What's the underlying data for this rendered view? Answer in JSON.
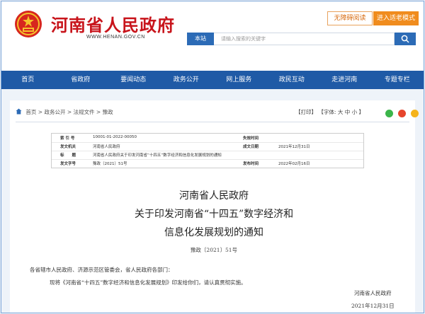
{
  "header": {
    "site_title": "河南省人民政府",
    "site_domain": "WWW.HENAN.GOV.CN",
    "accessible_label": "无障碍阅读",
    "elderly_label": "进入适老模式"
  },
  "search": {
    "scope_label": "本站",
    "placeholder": "请输入搜索的关键字"
  },
  "nav": {
    "items": [
      "首页",
      "省政府",
      "要闻动态",
      "政务公开",
      "网上服务",
      "政民互动",
      "走进河南",
      "专题专栏"
    ]
  },
  "breadcrumb": [
    "首页",
    "政务公开",
    "法规文件",
    "豫政"
  ],
  "tools": {
    "print": "【打印】",
    "font_label": "【字体:",
    "font_large": "大",
    "font_medium": "中",
    "font_small": "小",
    "font_end": "】"
  },
  "info": {
    "index_label": "索 引 号",
    "index_value": "10001-01-2022-00050",
    "validity_label": "失效时间",
    "validity_value": "",
    "issuer_label": "发文机关",
    "issuer_value": "河南省人民政府",
    "written_label": "成文日期",
    "written_value": "2021年12月31日",
    "subject_label": "标　　题",
    "subject_value": "河南省人民政府关于印发河南省“十四五”数字经济和信息化发展规划的通知",
    "docno_label": "发文字号",
    "docno_value": "豫政〔2021〕51号",
    "published_label": "发布时间",
    "published_value": "2022年02月16日"
  },
  "document": {
    "title_line1": "河南省人民政府",
    "title_line2": "关于印发河南省“十四五”数字经济和",
    "title_line3": "信息化发展规划的通知",
    "number": "豫政〔2021〕51号",
    "recipients": "各省辖市人民政府、济源示范区管委会，省人民政府各部门：",
    "body": "现将《河南省“十四五”数字经济和信息化发展规划》印发给你们，请认真贯彻实施。",
    "signature_org": "河南省人民政府",
    "signature_date": "2021年12月31日"
  },
  "colors": {
    "brand_red": "#c8141b",
    "nav_blue": "#1f5aa6",
    "accent_orange": "#f08c1e"
  }
}
